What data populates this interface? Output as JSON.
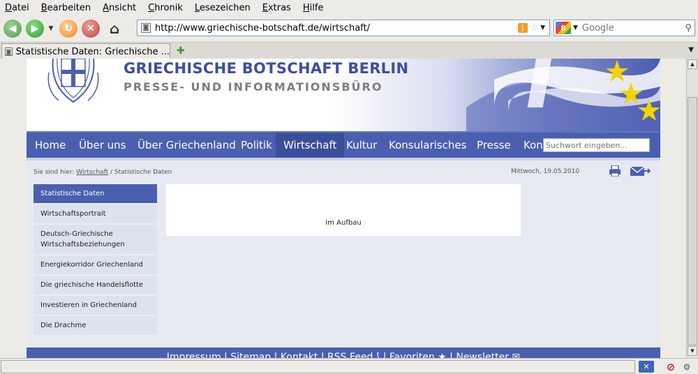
{
  "menubar": {
    "items": [
      "Datei",
      "Bearbeiten",
      "Ansicht",
      "Chronik",
      "Lesezeichen",
      "Extras",
      "Hilfe"
    ]
  },
  "toolbar": {
    "url": "http://www.griechische-botschaft.de/wirtschaft/",
    "search_placeholder": "Google"
  },
  "tabs": {
    "active_label": "Statistische Daten: Griechische ..."
  },
  "header": {
    "title": "GRIECHISCHE BOTSCHAFT BERLIN",
    "subtitle": "PRESSE- UND INFORMATIONSBÜRO"
  },
  "nav": {
    "items": [
      "Home",
      "Über uns",
      "Über Griechenland",
      "Politik",
      "Wirtschaft",
      "Kultur",
      "Konsularisches",
      "Presse",
      "Kon"
    ],
    "active": "Wirtschaft",
    "search_placeholder": "Suchwort eingeben..."
  },
  "breadcrumb": {
    "prefix": "Sie sind hier:",
    "link": "Wirtschaft",
    "current": "/ Statistische Daten"
  },
  "date": "Mittwoch, 19.05.2010",
  "sidebar": {
    "items": [
      "Statistische Daten",
      "Wirtschaftsportrait",
      "Deutsch-Griechische Wirtschaftsbeziehungen",
      "Energiekorridor Griechenland",
      "Die griechische Handelsflotte",
      "Investieren in Griechenland",
      "Die Drachme"
    ]
  },
  "content": {
    "text": "Im Aufbau"
  },
  "footer": {
    "text": "Impressum | Sitemap | Kontakt | RSS Feed ⟆ | Favoriten ★ | Newsletter ✉"
  },
  "icons": {
    "print": "printer-icon",
    "mail": "mail-icon",
    "rss": "rss-icon",
    "bookmark": "star-icon"
  },
  "colors": {
    "nav_blue": "#4a5fb0",
    "title_blue": "#3e4ea2",
    "page_bg": "#e6e9f1"
  }
}
